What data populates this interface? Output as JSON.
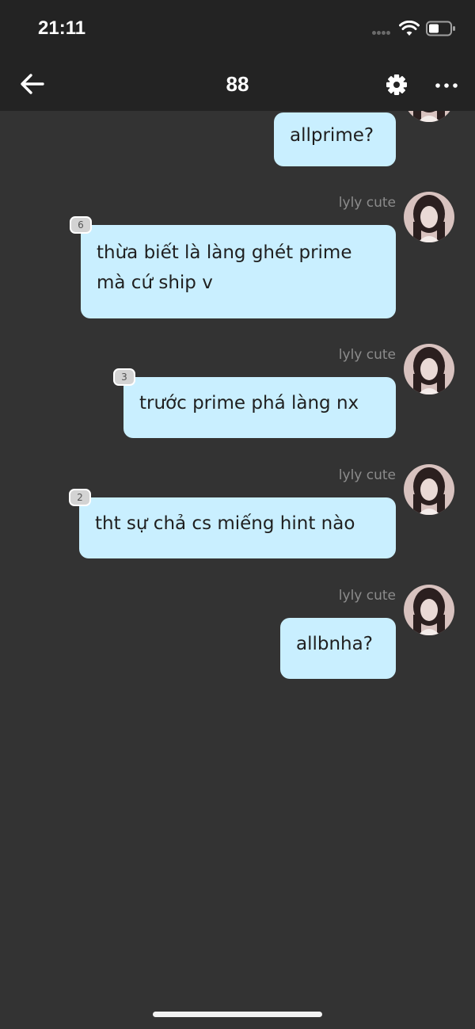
{
  "status_bar": {
    "time": "21:11",
    "icons": [
      "signal-dots-icon",
      "wifi-icon",
      "battery-icon"
    ]
  },
  "header": {
    "title": "88",
    "back_icon": "back-arrow-icon",
    "settings_icon": "gear-icon",
    "more_icon": "more-dots-icon"
  },
  "messages": [
    {
      "id": "m1",
      "text": "allprime?",
      "sender": "",
      "reply_count": ""
    },
    {
      "id": "m2",
      "sender": "lyly cute",
      "lines": [
        "thừa biết là làng ghét prime",
        "mà cứ ship v"
      ],
      "reply_count": "6"
    },
    {
      "id": "m3",
      "sender": "lyly cute",
      "text": "trước prime phá làng nx",
      "reply_count": "3"
    },
    {
      "id": "m4",
      "sender": "lyly cute",
      "text": "tht sự chả cs miếng hint nào",
      "reply_count": "2"
    },
    {
      "id": "m5",
      "sender": "lyly cute",
      "text": "allbnha?",
      "reply_count": ""
    }
  ],
  "colors": {
    "background": "#333333",
    "bar": "#232323",
    "bubble": "#c9efff",
    "bubble_text": "#1f1f1f",
    "sender_name": "#8c8c8c"
  }
}
